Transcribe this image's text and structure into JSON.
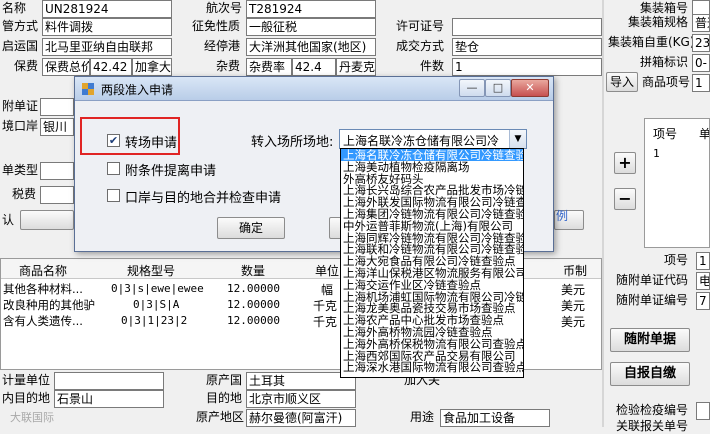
{
  "form_top": {
    "name_label": "名称",
    "name_value": "UN281924",
    "flight_label": "航次号",
    "flight_value": "T281924",
    "supervision_label": "管方式",
    "supervision_value": "料件调拨",
    "tax_label": "征免性质",
    "tax_value": "一般征税",
    "license_label": "许可证号",
    "license_value": "",
    "origin_country_label": "启运国",
    "origin_country_value": "北马里亚纳自由联邦",
    "via_port_label": "经停港",
    "via_port_value": "大洋洲其他国家(地区)",
    "deal_label": "成交方式",
    "deal_value": "垫仓",
    "insurance_label": "保费",
    "insurance_value_a": "保费总价",
    "insurance_value_b": "42.42",
    "insurance_value_c": "加拿大",
    "misc_label": "杂费",
    "misc_value_a": "杂费率",
    "misc_value_b": "42.4",
    "misc_value_c": "丹麦克",
    "pieces_label": "件数",
    "pieces_value": "1",
    "attached_doc_label": "附单证",
    "entry_port_label": "境口岸",
    "entry_port_value": "银川",
    "doc_type_label": "单类型",
    "tax_fee_label": "税费",
    "confirm_label": "认"
  },
  "right_panel": {
    "quarantine_label": "集装箱号",
    "spec_label": "集装箱规格",
    "spec_value": "普通2",
    "weight_label": "集装箱自重(KG)",
    "weight_value": "23",
    "flag_label": "拼箱标识",
    "flag_value": "0-",
    "import_button": "导入",
    "goods_no_label": "商品项号",
    "goods_no_value": "1",
    "grid_col1": "项号",
    "grid_col2": "单",
    "grid_value": "1",
    "item_no_label": "项号",
    "item_no_value": "1",
    "attached_code_label": "随附单证代码",
    "attached_code_value": "电",
    "attached_num_label": "随附单证编号",
    "attached_num_value": "7",
    "attach_doc_button": "随附单据",
    "self_report_button": "自报自缴",
    "inspect_no_label": "检验检疫编号",
    "inspect_no_value": "",
    "related_label": "关联报关单号",
    "plus": "+",
    "minus": "−",
    "hint": "例"
  },
  "goods_table": {
    "headers": [
      "商品名称",
      "规格型号",
      "数量",
      "单位",
      "币制"
    ],
    "rows": [
      [
        "其他各种材料...",
        "0|3|s|ewe|ewee",
        "12.00000",
        "幅",
        "美元"
      ],
      [
        "改良种用的其他驴",
        "0|3|S|A",
        "12.00000",
        "千克",
        "美元"
      ],
      [
        "含有人类遗传...",
        "0|3|1|23|2",
        "12.00000",
        "千克",
        "美元"
      ]
    ]
  },
  "form_bottom": {
    "unit_label": "计量单位",
    "dest_label": "内目的地",
    "dest_value": "石景山",
    "origin_label": "原产国",
    "origin_value": "土耳其",
    "dest_area_label": "目的地",
    "dest_area_value": "北京市顺义区",
    "origin_region_label": "原产地区",
    "origin_region_value": "赫尔曼德(阿富汗)",
    "purpose_label": "用途",
    "purpose_value": "食品加工设备",
    "entry_value": "加入关",
    "watermark": "大联国际"
  },
  "dialog": {
    "title": "两段准入申请",
    "checkbox_transfer": "转场申请",
    "checkbox_transfer_checked": true,
    "checkbox_conditional": "附条件提离申请",
    "checkbox_conditional_checked": false,
    "checkbox_port": "口岸与目的地合并检查申请",
    "checkbox_port_checked": false,
    "transfer_place_label": "转入场所场地:",
    "transfer_place_selected": "上海名联冷冻仓储有限公司冷",
    "confirm_button": "确定",
    "cancel_button": "取消",
    "minimize": "—",
    "maximize": "□",
    "close": "✕"
  },
  "dropdown_options": [
    "上海名联冷冻仓储有限公司冷链查验",
    "上海美动植物检疫隔离场",
    "外高桥友好码头",
    "上海长兴岛综合农产品批发市场冷链",
    "上海外联发国际物流有限公司冷链查",
    "上海集团冷链物流有限公司冷链查验",
    "中外运普菲斯物流(上海)有限公司",
    "上海同辉冷链物流有限公司冷链查验",
    "上海联和冷链物流有限公司冷链查验",
    "上海大宛食品有限公司冷链查验点",
    "上海洋山保税港区物流服务有限公司",
    "上海交运作业区冷链查验点",
    "上海机场浦虹国际物流有限公司冷链",
    "上海龙美奥品瓷技交易市场查验点",
    "上海农产品中心批发市场查验点",
    "上海外高桥物流园冷链查验点",
    "上海外高桥保税物流有限公司查验点",
    "上海西郊国际农产品交易有限公司",
    "上海深水港国际物流有限公司查验点"
  ]
}
